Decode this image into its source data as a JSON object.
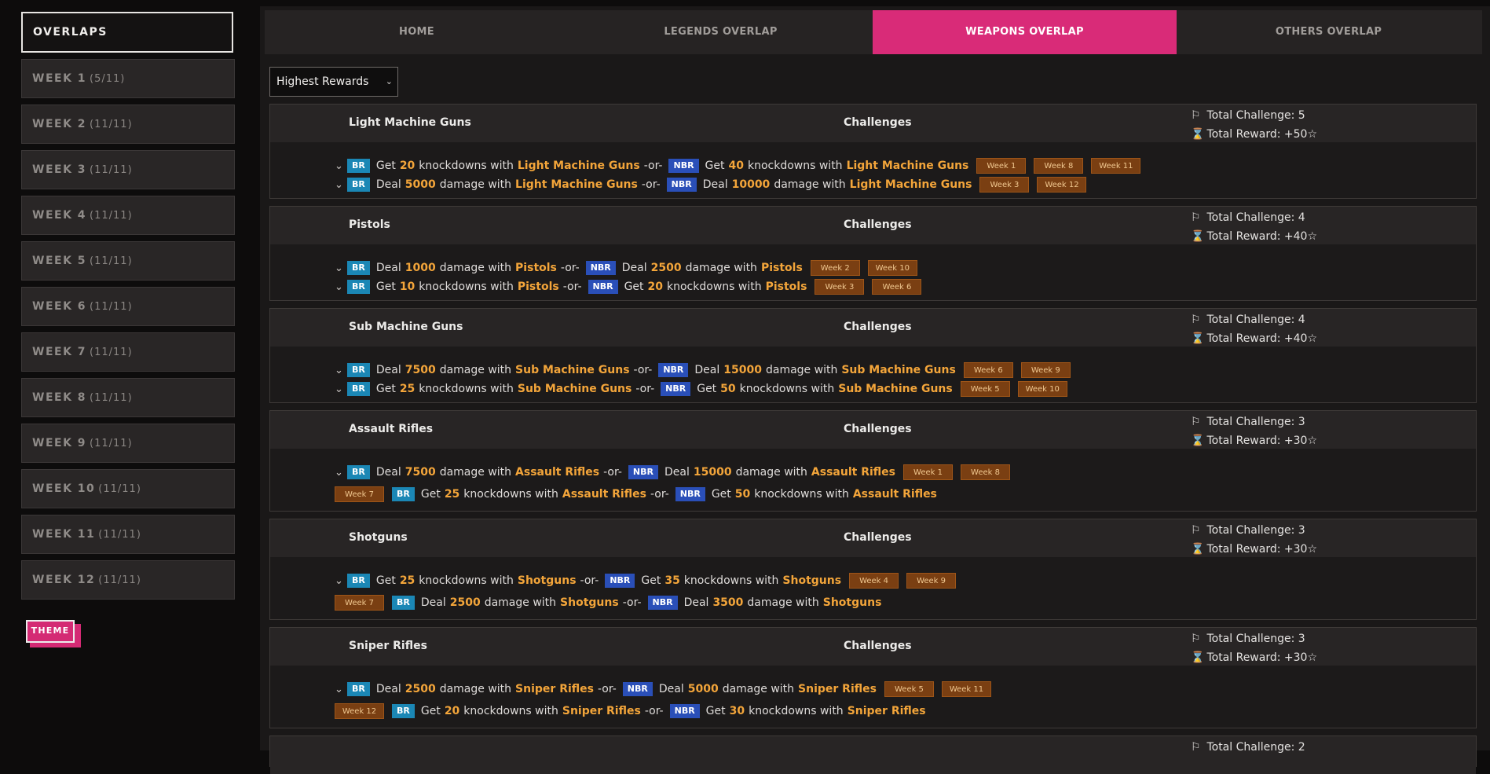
{
  "sidebar": {
    "title": "OVERLAPS",
    "weeks": [
      {
        "label": "WEEK 1",
        "count": "(5/11)"
      },
      {
        "label": "WEEK 2",
        "count": "(11/11)"
      },
      {
        "label": "WEEK 3",
        "count": "(11/11)"
      },
      {
        "label": "WEEK 4",
        "count": "(11/11)"
      },
      {
        "label": "WEEK 5",
        "count": "(11/11)"
      },
      {
        "label": "WEEK 6",
        "count": "(11/11)"
      },
      {
        "label": "WEEK 7",
        "count": "(11/11)"
      },
      {
        "label": "WEEK 8",
        "count": "(11/11)"
      },
      {
        "label": "WEEK 9",
        "count": "(11/11)"
      },
      {
        "label": "WEEK 10",
        "count": "(11/11)"
      },
      {
        "label": "WEEK 11",
        "count": "(11/11)"
      },
      {
        "label": "WEEK 12",
        "count": "(11/11)"
      }
    ],
    "theme_label": "THEME"
  },
  "tabs": [
    {
      "label": "HOME",
      "active": false
    },
    {
      "label": "LEGENDS OVERLAP",
      "active": false
    },
    {
      "label": "WEAPONS OVERLAP",
      "active": true
    },
    {
      "label": "OTHERS OVERLAP",
      "active": false
    }
  ],
  "sort_select": {
    "value": "Highest Rewards"
  },
  "labels": {
    "challenges": "Challenges",
    "or": "-or-",
    "br": "BR",
    "nbr": "NBR"
  },
  "groups": [
    {
      "name": "Light Machine Guns",
      "total_challenge": "Total Challenge: 5",
      "total_reward": "Total Reward: +50☆",
      "rows": [
        {
          "caret": true,
          "br": {
            "verb": "Get",
            "num": "20",
            "mid": "knockdowns with",
            "weapon": "Light Machine Guns"
          },
          "nbr": {
            "verb": "Get",
            "num": "40",
            "mid": "knockdowns with",
            "weapon": "Light Machine Guns"
          },
          "weeks": [
            "Week 1",
            "Week 8",
            "Week 11"
          ]
        },
        {
          "caret": true,
          "br": {
            "verb": "Deal",
            "num": "5000",
            "mid": "damage with",
            "weapon": "Light Machine Guns"
          },
          "nbr": {
            "verb": "Deal",
            "num": "10000",
            "mid": "damage with",
            "weapon": "Light Machine Guns"
          },
          "weeks": [
            "Week 3",
            "Week 12"
          ]
        }
      ]
    },
    {
      "name": "Pistols",
      "total_challenge": "Total Challenge: 4",
      "total_reward": "Total Reward: +40☆",
      "rows": [
        {
          "caret": true,
          "br": {
            "verb": "Deal",
            "num": "1000",
            "mid": "damage with",
            "weapon": "Pistols"
          },
          "nbr": {
            "verb": "Deal",
            "num": "2500",
            "mid": "damage with",
            "weapon": "Pistols"
          },
          "weeks": [
            "Week 2",
            "Week 10"
          ]
        },
        {
          "caret": true,
          "br": {
            "verb": "Get",
            "num": "10",
            "mid": "knockdowns with",
            "weapon": "Pistols"
          },
          "nbr": {
            "verb": "Get",
            "num": "20",
            "mid": "knockdowns with",
            "weapon": "Pistols"
          },
          "weeks": [
            "Week 3",
            "Week 6"
          ]
        }
      ]
    },
    {
      "name": "Sub Machine Guns",
      "total_challenge": "Total Challenge: 4",
      "total_reward": "Total Reward: +40☆",
      "rows": [
        {
          "caret": true,
          "br": {
            "verb": "Deal",
            "num": "7500",
            "mid": "damage with",
            "weapon": "Sub Machine Guns"
          },
          "nbr": {
            "verb": "Deal",
            "num": "15000",
            "mid": "damage with",
            "weapon": "Sub Machine Guns"
          },
          "weeks": [
            "Week 6",
            "Week 9"
          ]
        },
        {
          "caret": true,
          "br": {
            "verb": "Get",
            "num": "25",
            "mid": "knockdowns with",
            "weapon": "Sub Machine Guns"
          },
          "nbr": {
            "verb": "Get",
            "num": "50",
            "mid": "knockdowns with",
            "weapon": "Sub Machine Guns"
          },
          "weeks": [
            "Week 5",
            "Week 10"
          ]
        }
      ]
    },
    {
      "name": "Assault Rifles",
      "total_challenge": "Total Challenge: 3",
      "total_reward": "Total Reward: +30☆",
      "rows": [
        {
          "caret": true,
          "br": {
            "verb": "Deal",
            "num": "7500",
            "mid": "damage with",
            "weapon": "Assault Rifles"
          },
          "nbr": {
            "verb": "Deal",
            "num": "15000",
            "mid": "damage with",
            "weapon": "Assault Rifles"
          },
          "weeks": [
            "Week 1",
            "Week 8"
          ]
        },
        {
          "caret": false,
          "lead_week": "Week 7",
          "br": {
            "verb": "Get",
            "num": "25",
            "mid": "knockdowns with",
            "weapon": "Assault Rifles"
          },
          "nbr": {
            "verb": "Get",
            "num": "50",
            "mid": "knockdowns with",
            "weapon": "Assault Rifles"
          },
          "weeks": []
        }
      ]
    },
    {
      "name": "Shotguns",
      "total_challenge": "Total Challenge: 3",
      "total_reward": "Total Reward: +30☆",
      "rows": [
        {
          "caret": true,
          "br": {
            "verb": "Get",
            "num": "25",
            "mid": "knockdowns with",
            "weapon": "Shotguns"
          },
          "nbr": {
            "verb": "Get",
            "num": "35",
            "mid": "knockdowns with",
            "weapon": "Shotguns"
          },
          "weeks": [
            "Week 4",
            "Week 9"
          ]
        },
        {
          "caret": false,
          "lead_week": "Week 7",
          "br": {
            "verb": "Deal",
            "num": "2500",
            "mid": "damage with",
            "weapon": "Shotguns"
          },
          "nbr": {
            "verb": "Deal",
            "num": "3500",
            "mid": "damage with",
            "weapon": "Shotguns"
          },
          "weeks": []
        }
      ]
    },
    {
      "name": "Sniper Rifles",
      "total_challenge": "Total Challenge: 3",
      "total_reward": "Total Reward: +30☆",
      "rows": [
        {
          "caret": true,
          "br": {
            "verb": "Deal",
            "num": "2500",
            "mid": "damage with",
            "weapon": "Sniper Rifles"
          },
          "nbr": {
            "verb": "Deal",
            "num": "5000",
            "mid": "damage with",
            "weapon": "Sniper Rifles"
          },
          "weeks": [
            "Week 5",
            "Week 11"
          ]
        },
        {
          "caret": false,
          "lead_week": "Week 12",
          "br": {
            "verb": "Get",
            "num": "20",
            "mid": "knockdowns with",
            "weapon": "Sniper Rifles"
          },
          "nbr": {
            "verb": "Get",
            "num": "30",
            "mid": "knockdowns with",
            "weapon": "Sniper Rifles"
          },
          "weeks": []
        }
      ]
    },
    {
      "name": "",
      "total_challenge": "Total Challenge: 2",
      "total_reward": "",
      "rows": []
    }
  ]
}
